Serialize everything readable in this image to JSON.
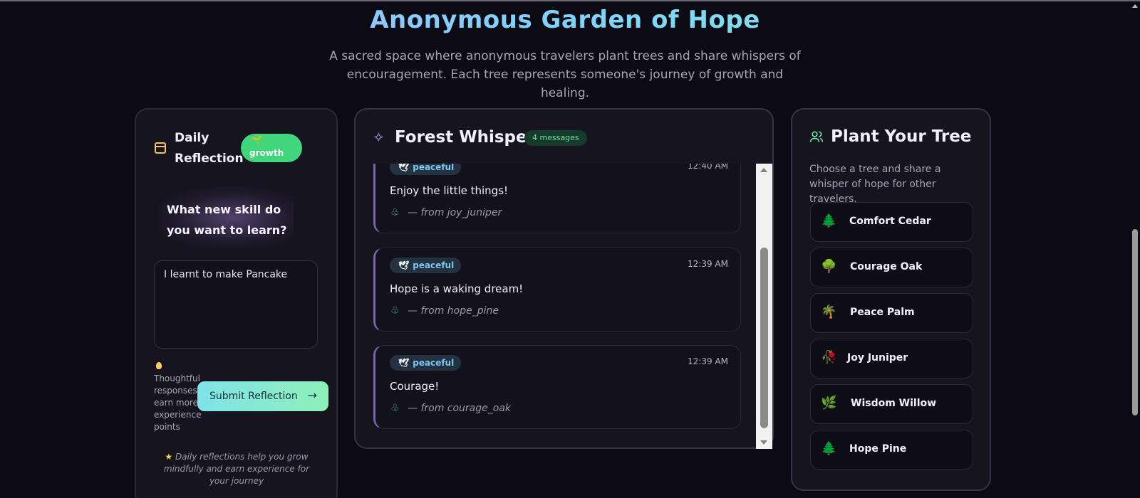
{
  "hero": {
    "title": "Anonymous Garden of Hope",
    "subtitle": "A sacred space where anonymous travelers plant trees and share whispers of encouragement. Each tree represents someone's journey of growth and healing."
  },
  "daily": {
    "title": "Daily Reflection",
    "badge": "growth",
    "prompt": "What new skill do you want to learn?",
    "reflection_value": "I learnt to make Pancake",
    "tip": "Thoughtful responses earn more experience points",
    "submit_label": "Submit Reflection",
    "note": "Daily reflections help you grow mindfully and earn experience for your journey"
  },
  "forest": {
    "title": "Forest Whispers",
    "count": "4 messages",
    "messages": [
      {
        "tag": "peaceful",
        "time": "12:40 AM",
        "text": "Enjoy the little things!",
        "from": "— from joy_juniper"
      },
      {
        "tag": "peaceful",
        "time": "12:39 AM",
        "text": "Hope is a waking dream!",
        "from": "— from hope_pine"
      },
      {
        "tag": "peaceful",
        "time": "12:39 AM",
        "text": "Courage!",
        "from": "— from courage_oak"
      }
    ]
  },
  "plant": {
    "title": "Plant Your Tree",
    "description": "Choose a tree and share a whisper of hope for other travelers.",
    "trees": [
      {
        "emoji": "🌲",
        "name": "Comfort Cedar"
      },
      {
        "emoji": "🌳",
        "name": "Courage Oak"
      },
      {
        "emoji": "🌴",
        "name": "Peace Palm"
      },
      {
        "emoji": "🥀",
        "name": "Joy Juniper"
      },
      {
        "emoji": "🌿",
        "name": "Wisdom Willow"
      },
      {
        "emoji": "🌲",
        "name": "Hope Pine"
      }
    ]
  },
  "colors": {
    "background": "#0c0b14",
    "card": "#16141f",
    "accent_green": "#3fd67c",
    "accent_purple": "#7a63a8",
    "tag_blue": "#7cc7f0"
  }
}
